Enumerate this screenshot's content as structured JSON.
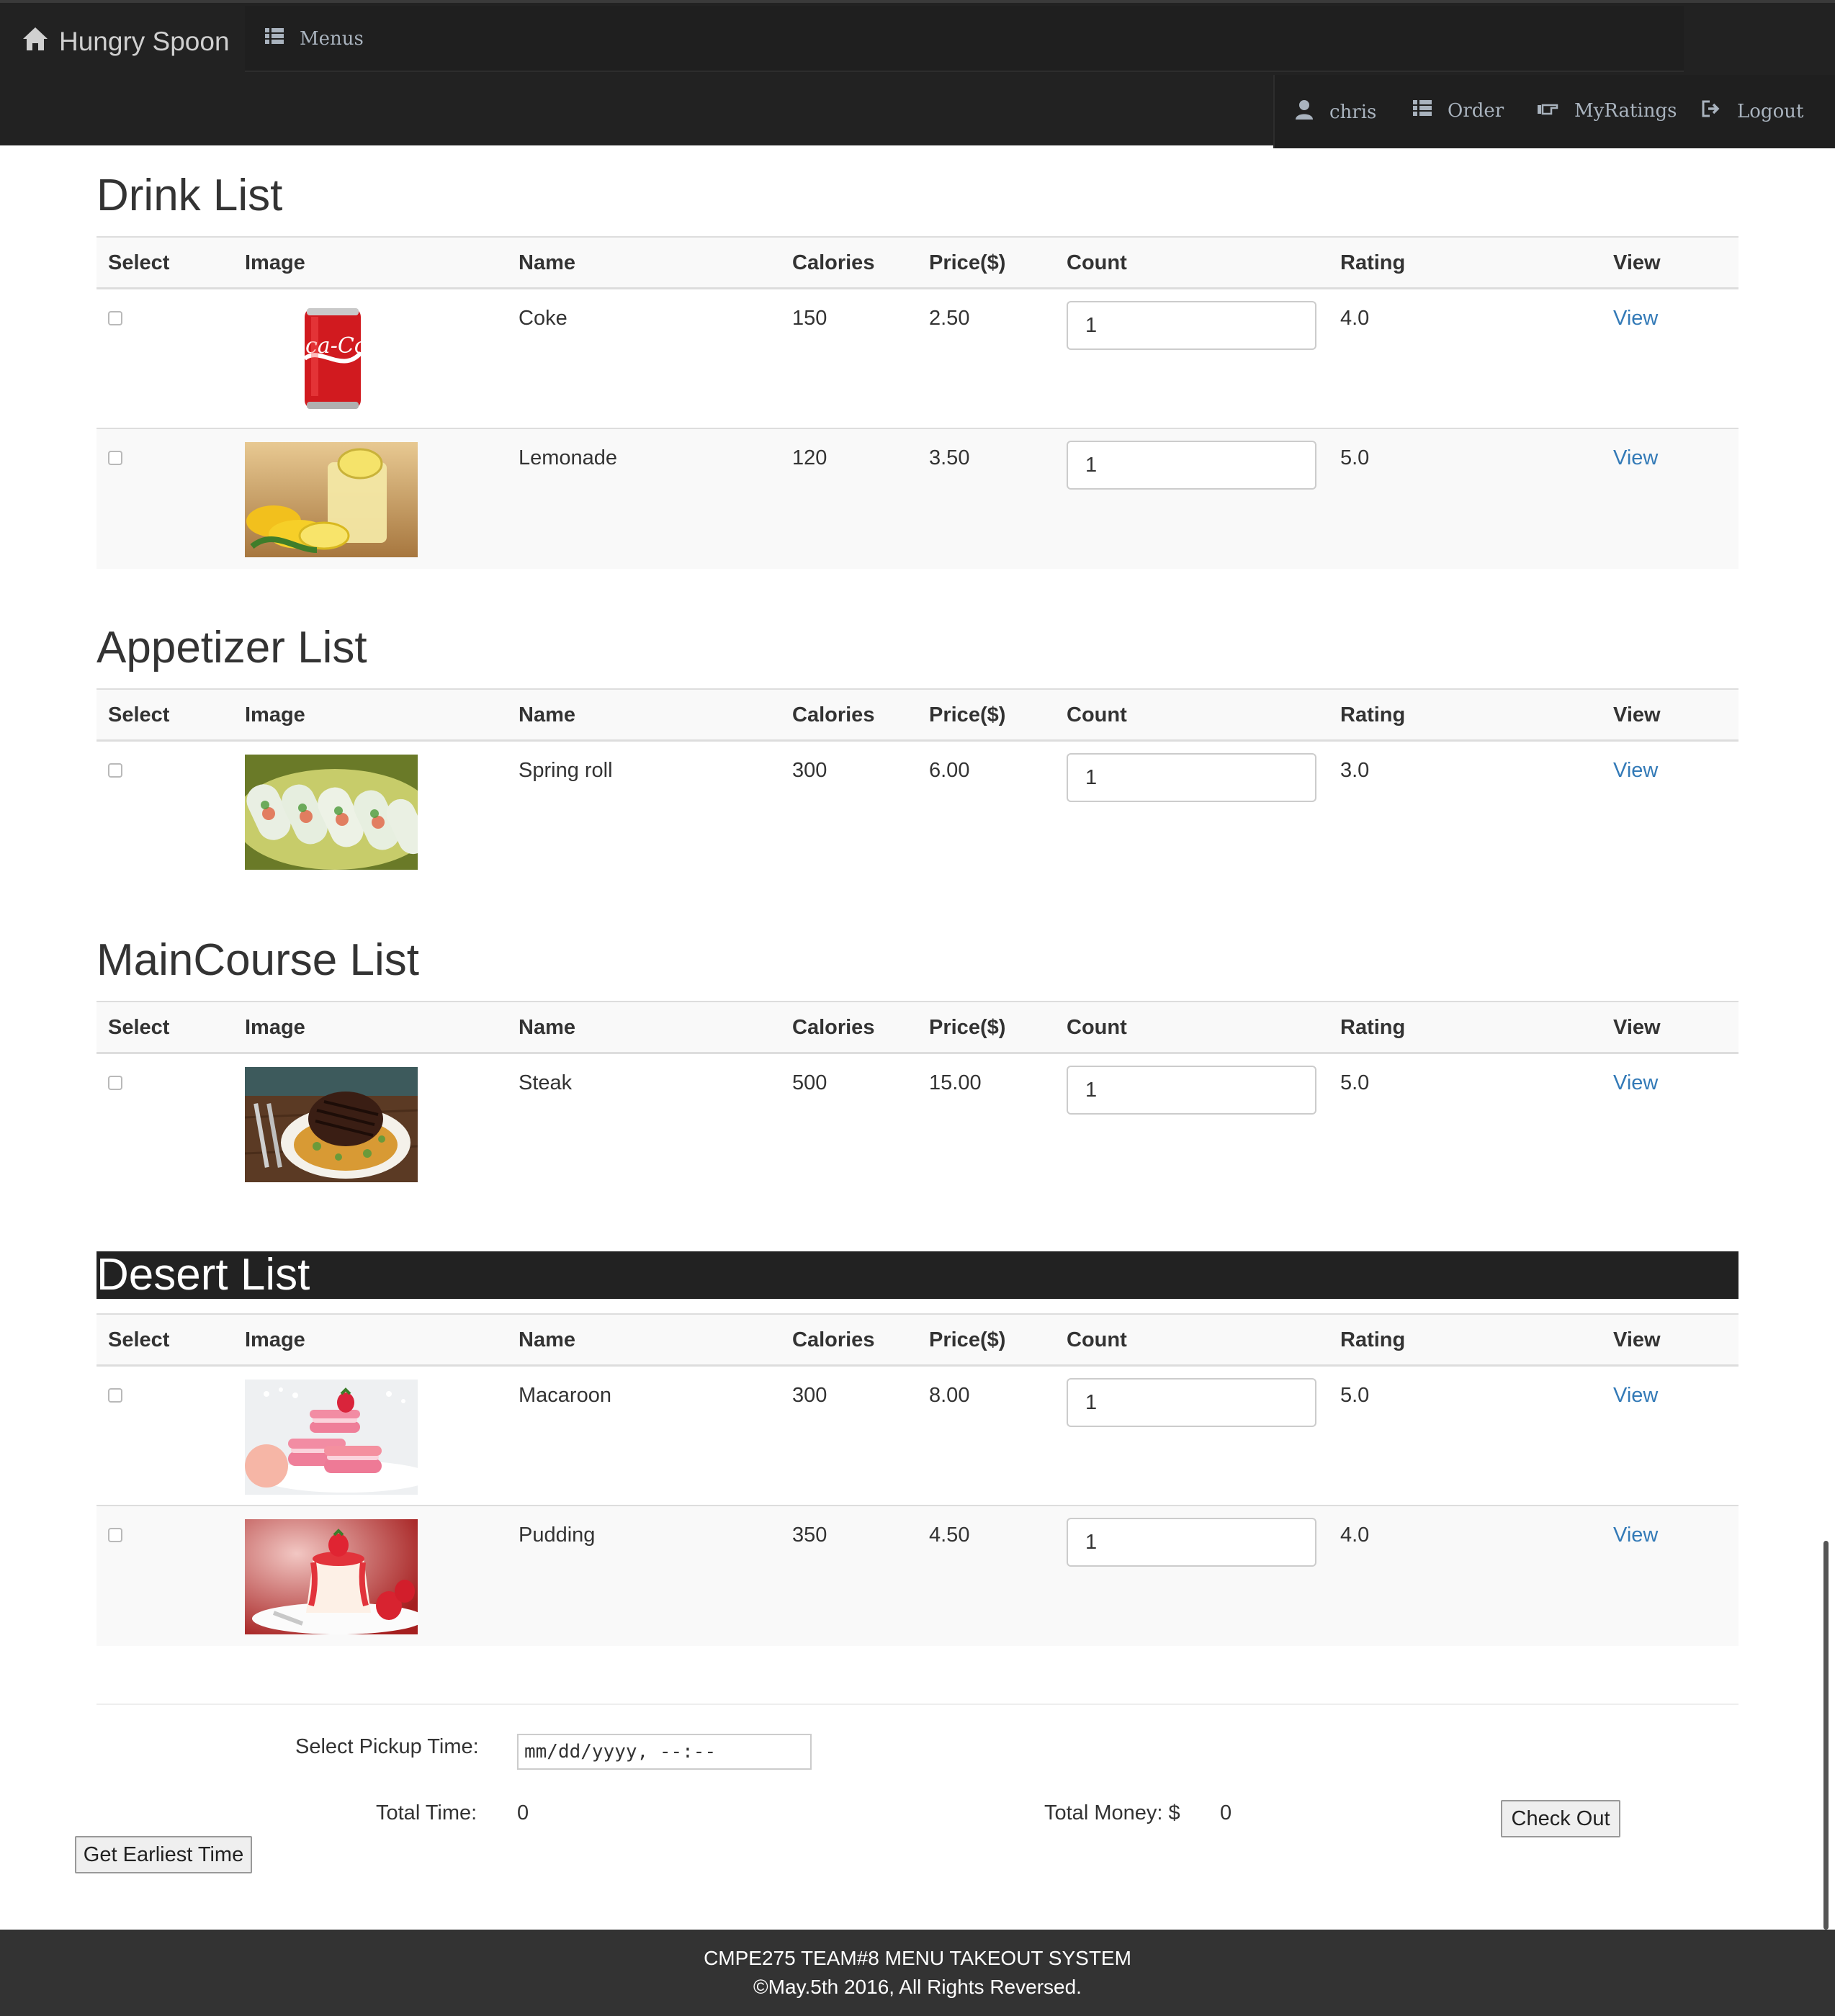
{
  "brand": {
    "name": "Hungry Spoon",
    "icon": "home-icon"
  },
  "nav": {
    "menus_label": "Menus",
    "user_label": "chris",
    "order_label": "Order",
    "myratings_label": "MyRatings",
    "logout_label": "Logout"
  },
  "table_headers": {
    "select": "Select",
    "image": "Image",
    "name": "Name",
    "calories": "Calories",
    "price": "Price($)",
    "count": "Count",
    "rating": "Rating",
    "view": "View"
  },
  "sections": {
    "drink": {
      "title": "Drink List",
      "items": [
        {
          "name": "Coke",
          "calories": "150",
          "price": "2.50",
          "count": "1",
          "rating": "4.0",
          "view": "View",
          "image": "coke-can"
        },
        {
          "name": "Lemonade",
          "calories": "120",
          "price": "3.50",
          "count": "1",
          "rating": "5.0",
          "view": "View",
          "image": "lemonade"
        }
      ]
    },
    "appetizer": {
      "title": "Appetizer List",
      "items": [
        {
          "name": "Spring roll",
          "calories": "300",
          "price": "6.00",
          "count": "1",
          "rating": "3.0",
          "view": "View",
          "image": "spring-rolls"
        }
      ]
    },
    "maincourse": {
      "title": "MainCourse List",
      "items": [
        {
          "name": "Steak",
          "calories": "500",
          "price": "15.00",
          "count": "1",
          "rating": "5.0",
          "view": "View",
          "image": "steak"
        }
      ]
    },
    "desert": {
      "title": "Desert List",
      "items": [
        {
          "name": "Macaroon",
          "calories": "300",
          "price": "8.00",
          "count": "1",
          "rating": "5.0",
          "view": "View",
          "image": "macaroons"
        },
        {
          "name": "Pudding",
          "calories": "350",
          "price": "4.50",
          "count": "1",
          "rating": "4.0",
          "view": "View",
          "image": "panna-cotta"
        }
      ]
    }
  },
  "order_form": {
    "pickup_label": "Select Pickup Time:",
    "pickup_placeholder": "mm/dd/yyyy, --:--",
    "total_time_label": "Total Time:",
    "total_time_value": "0",
    "total_money_label": "Total Money: $",
    "total_money_value": "0",
    "checkout_label": "Check Out",
    "earliest_label": "Get Earliest Time"
  },
  "footer": {
    "line1": "CMPE275 TEAM#8 MENU TAKEOUT SYSTEM",
    "line2": "©May.5th 2016, All Rights Reversed."
  },
  "colors": {
    "navbar": "#222222",
    "link": "#337ab7",
    "footer": "#333333",
    "stripe": "#f9f9f9"
  }
}
